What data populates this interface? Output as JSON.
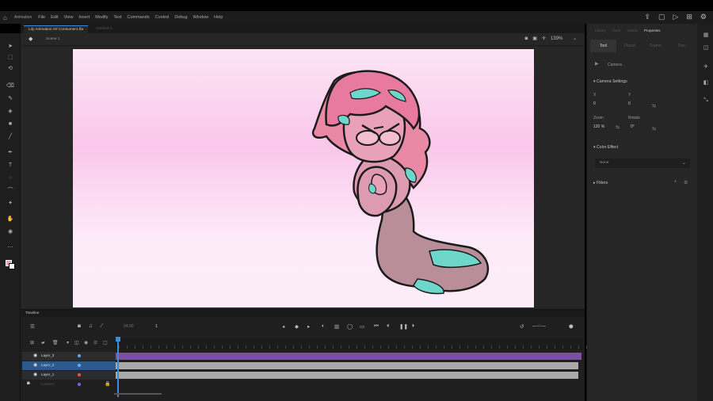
{
  "app": {
    "workspace": "Animation",
    "menu": [
      "File",
      "Edit",
      "View",
      "Insert",
      "Modify",
      "Text",
      "Commands",
      "Control",
      "Debug",
      "Window",
      "Help"
    ]
  },
  "document": {
    "tab_active": "Lily Animation ref Consumer1.fla",
    "tab_inactive": "Untitled-1"
  },
  "editbar": {
    "scene": "Scene 1",
    "zoom": "139%"
  },
  "properties": {
    "tabs_top": [
      "Library",
      "Color",
      "Assets",
      "Properties"
    ],
    "subtabs": [
      "Tool",
      "Object",
      "Frame",
      "Doc"
    ],
    "tool_name": "Camera",
    "camera_settings_label": "Camera Settings",
    "pos_x_label": "X",
    "pos_y_label": "Y",
    "pos_x": "0",
    "pos_y": "0",
    "zoom_label": "Zoom",
    "rotate_label": "Rotate",
    "zoom_value": "120 %",
    "rotate_value": "0°",
    "color_effect_label": "Color Effect",
    "color_effect_value": "None",
    "filters_label": "Filters"
  },
  "timeline": {
    "title": "Timeline",
    "fps": "24.00",
    "frame": "1",
    "layers": [
      {
        "name": "Layer_3",
        "selected": false,
        "color": "#5ea8ff"
      },
      {
        "name": "Layer_2",
        "selected": true,
        "color": "#5ea8ff"
      },
      {
        "name": "Layer_1",
        "selected": false,
        "color": "#ff4a4a"
      },
      {
        "name": "Camera",
        "selected": false,
        "color": "#8a5cff"
      }
    ]
  },
  "colors": {
    "accent": "#3a8bd8",
    "frames_purple": "#7b4fa3",
    "frames_gray": "#a9a9a9",
    "stroke_swatch": "#e9a5b5"
  }
}
